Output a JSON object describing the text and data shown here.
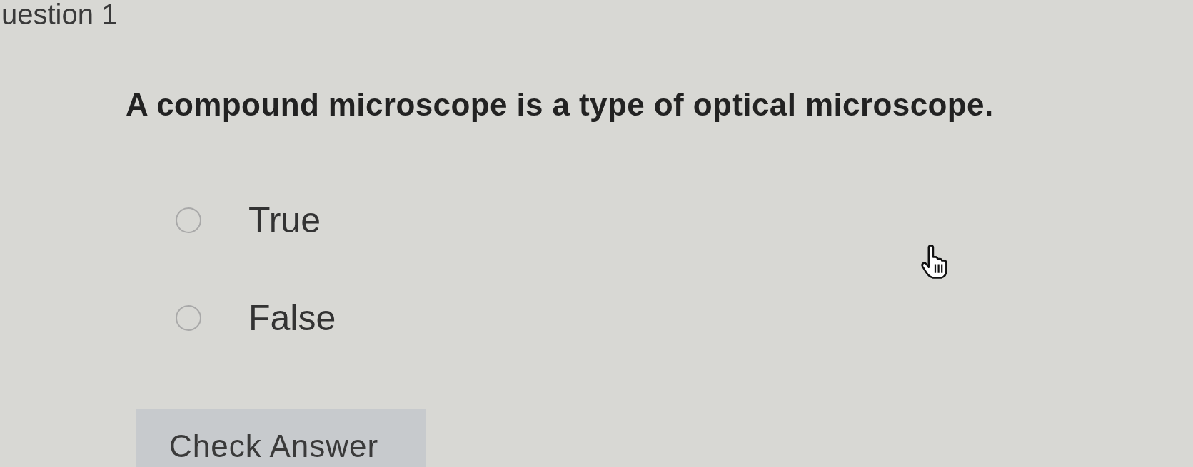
{
  "header": {
    "title": "uestion 1"
  },
  "question": {
    "text": "A compound microscope is a type of optical microscope."
  },
  "options": [
    {
      "label": "True",
      "selected": false
    },
    {
      "label": "False",
      "selected": false
    }
  ],
  "button": {
    "label": "Check Answer"
  }
}
